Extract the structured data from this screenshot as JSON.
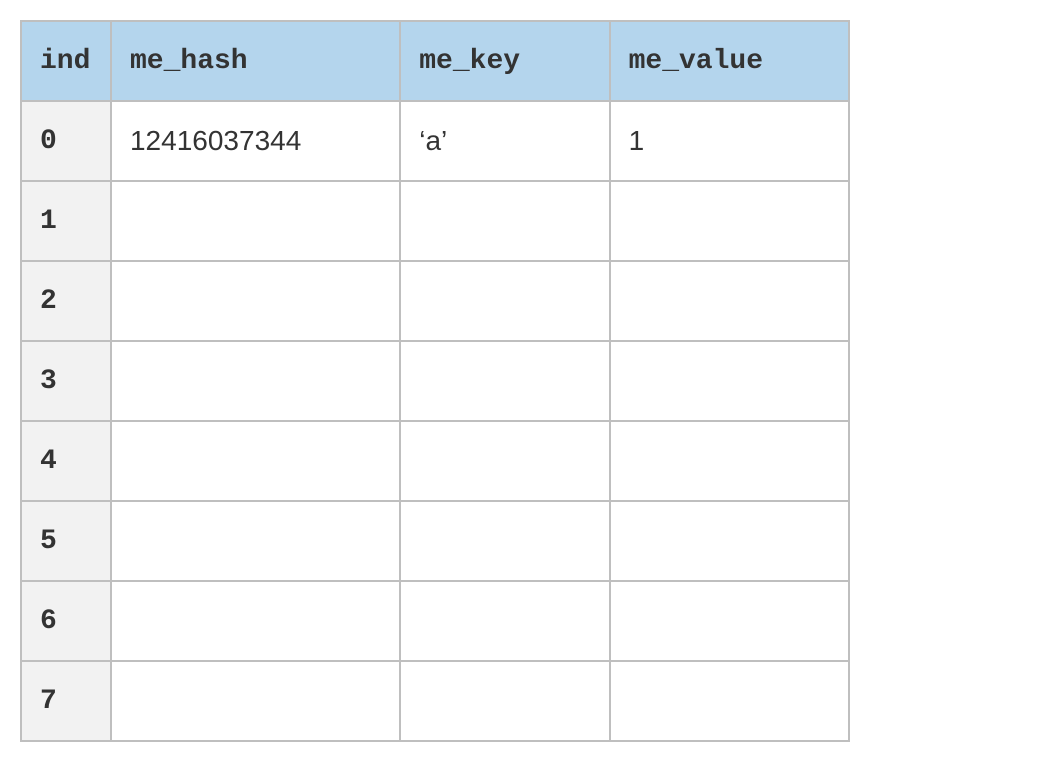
{
  "headers": {
    "ind": "ind",
    "me_hash": "me_hash",
    "me_key": "me_key",
    "me_value": "me_value"
  },
  "rows": [
    {
      "ind": "0",
      "me_hash": "12416037344",
      "me_key": "‘a’",
      "me_value": "1"
    },
    {
      "ind": "1",
      "me_hash": "",
      "me_key": "",
      "me_value": ""
    },
    {
      "ind": "2",
      "me_hash": "",
      "me_key": "",
      "me_value": ""
    },
    {
      "ind": "3",
      "me_hash": "",
      "me_key": "",
      "me_value": ""
    },
    {
      "ind": "4",
      "me_hash": "",
      "me_key": "",
      "me_value": ""
    },
    {
      "ind": "5",
      "me_hash": "",
      "me_key": "",
      "me_value": ""
    },
    {
      "ind": "6",
      "me_hash": "",
      "me_key": "",
      "me_value": ""
    },
    {
      "ind": "7",
      "me_hash": "",
      "me_key": "",
      "me_value": ""
    }
  ],
  "chart_data": {
    "type": "table",
    "title": "",
    "columns": [
      "ind",
      "me_hash",
      "me_key",
      "me_value"
    ],
    "data": [
      [
        0,
        12416037344,
        "'a'",
        1
      ],
      [
        1,
        null,
        null,
        null
      ],
      [
        2,
        null,
        null,
        null
      ],
      [
        3,
        null,
        null,
        null
      ],
      [
        4,
        null,
        null,
        null
      ],
      [
        5,
        null,
        null,
        null
      ],
      [
        6,
        null,
        null,
        null
      ],
      [
        7,
        null,
        null,
        null
      ]
    ]
  }
}
